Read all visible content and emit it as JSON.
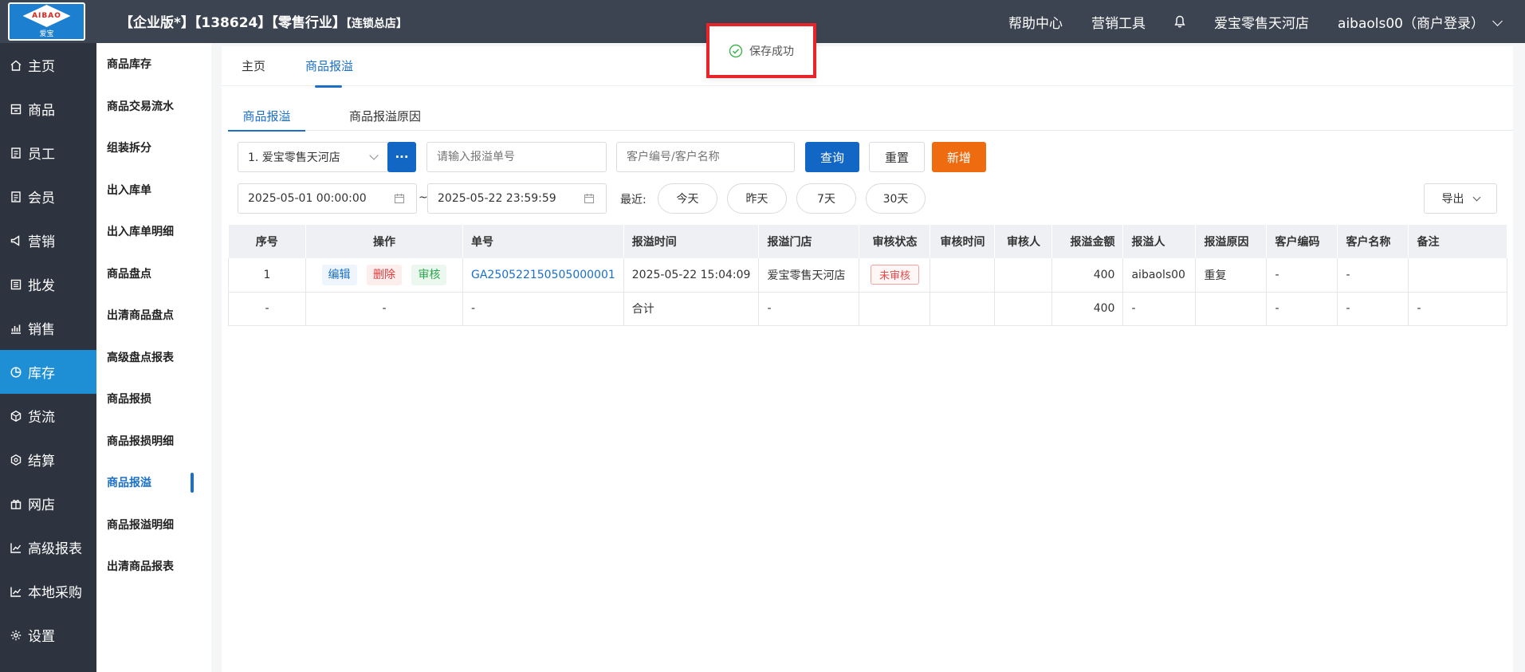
{
  "topbar": {
    "logo_text": "AIBAO",
    "logo_sub": "爱宝",
    "title": "【企业版*】【138624】【零售行业】",
    "title_small": "【连锁总店】",
    "help": "帮助中心",
    "marketing_tools": "营销工具",
    "store": "爱宝零售天河店",
    "user": "aibaols00（商户登录）"
  },
  "sidemenu": [
    {
      "label": "主页",
      "icon": "home-icon"
    },
    {
      "label": "商品",
      "icon": "product-icon"
    },
    {
      "label": "员工",
      "icon": "staff-icon"
    },
    {
      "label": "会员",
      "icon": "member-icon"
    },
    {
      "label": "营销",
      "icon": "marketing-icon"
    },
    {
      "label": "批发",
      "icon": "wholesale-icon"
    },
    {
      "label": "销售",
      "icon": "sales-icon"
    },
    {
      "label": "库存",
      "icon": "stock-icon"
    },
    {
      "label": "货流",
      "icon": "logistics-icon"
    },
    {
      "label": "结算",
      "icon": "settlement-icon"
    },
    {
      "label": "网店",
      "icon": "gift-icon"
    },
    {
      "label": "高级报表",
      "icon": "report-icon"
    },
    {
      "label": "本地采购",
      "icon": "purchase-icon"
    },
    {
      "label": "设置",
      "icon": "gear-icon"
    }
  ],
  "submenu": [
    "商品库存",
    "商品交易流水",
    "组装拆分",
    "出入库单",
    "出入库单明细",
    "商品盘点",
    "出清商品盘点",
    "高级盘点报表",
    "商品报损",
    "商品报损明细",
    "商品报溢",
    "商品报溢明细",
    "出清商品报表"
  ],
  "page_tabs": [
    "主页",
    "商品报溢"
  ],
  "inner_tabs": [
    "商品报溢",
    "商品报溢原因"
  ],
  "filters": {
    "store_select": "1. 爱宝零售天河店",
    "more_btn": "···",
    "order_placeholder": "请输入报溢单号",
    "customer_placeholder": "客户编号/客户名称",
    "query": "查询",
    "reset": "重置",
    "add": "新增",
    "date_start": "2025-05-01 00:00:00",
    "date_sep": "~",
    "date_end": "2025-05-22 23:59:59",
    "recent_label": "最近:",
    "recent": [
      "今天",
      "昨天",
      "7天",
      "30天"
    ],
    "export": "导出"
  },
  "table": {
    "headers": [
      "序号",
      "操作",
      "单号",
      "报溢时间",
      "报溢门店",
      "审核状态",
      "审核时间",
      "审核人",
      "报溢金额",
      "报溢人",
      "报溢原因",
      "客户编码",
      "客户名称",
      "备注"
    ],
    "row": {
      "index": "1",
      "edit": "编辑",
      "delete": "删除",
      "audit": "审核",
      "order_no": "GA250522150505000001",
      "time": "2025-05-22 15:04:09",
      "store": "爱宝零售天河店",
      "status": "未审核",
      "audit_time": "",
      "auditor": "",
      "amount": "400",
      "person": "aibaols00",
      "reason": "重复",
      "cust_code": "-",
      "cust_name": "-",
      "remark": ""
    },
    "total": {
      "index": "-",
      "op": "-",
      "order_no": "-",
      "time": "合计",
      "store": "-",
      "amount": "400",
      "person": "-",
      "cust_code": "-",
      "cust_name": "-",
      "remark": "-"
    }
  },
  "toast": {
    "text": "保存成功"
  }
}
